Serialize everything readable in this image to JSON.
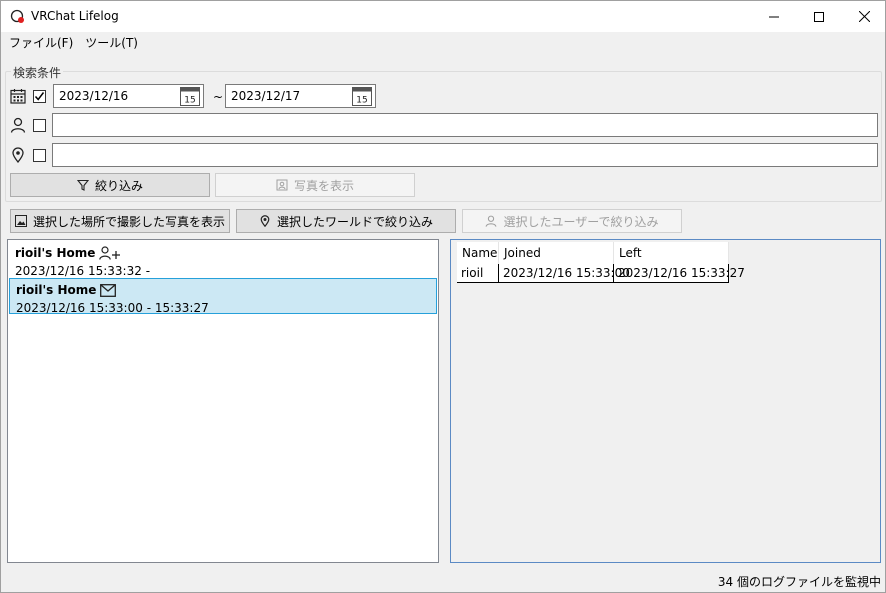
{
  "window": {
    "title": "VRChat Lifelog"
  },
  "menu": {
    "file": "ファイル(F)",
    "tools": "ツール(T)"
  },
  "search": {
    "group_label": "検索条件",
    "date_checked": true,
    "date_from": "2023/12/16",
    "date_to": "2023/12/17",
    "date_separator": "~",
    "calendar_day": "15",
    "user_value": "",
    "world_value": "",
    "filter_button": "絞り込み",
    "show_photos_button": "写真を表示"
  },
  "actions": {
    "show_photos_at_location": "選択した場所で撮影した写真を表示",
    "filter_by_world": "選択したワールドで絞り込み",
    "filter_by_user": "選択したユーザーで絞り込み"
  },
  "events": [
    {
      "title": "rioil's Home",
      "icon": "user-add-icon",
      "time": "2023/12/16 15:33:32 -"
    },
    {
      "title": "rioil's Home",
      "icon": "envelope-icon",
      "time": "2023/12/16 15:33:00 - 15:33:27",
      "selected": true
    }
  ],
  "users_table": {
    "columns": [
      "Name",
      "Joined",
      "Left"
    ],
    "rows": [
      [
        "rioil",
        "2023/12/16 15:33:00",
        "2023/12/16 15:33:27"
      ]
    ]
  },
  "status": {
    "text": "34 個のログファイルを監視中"
  },
  "colors": {
    "selection_bg": "#cce8f4",
    "selection_border": "#26a0da",
    "button_bg": "#e1e1e1"
  }
}
